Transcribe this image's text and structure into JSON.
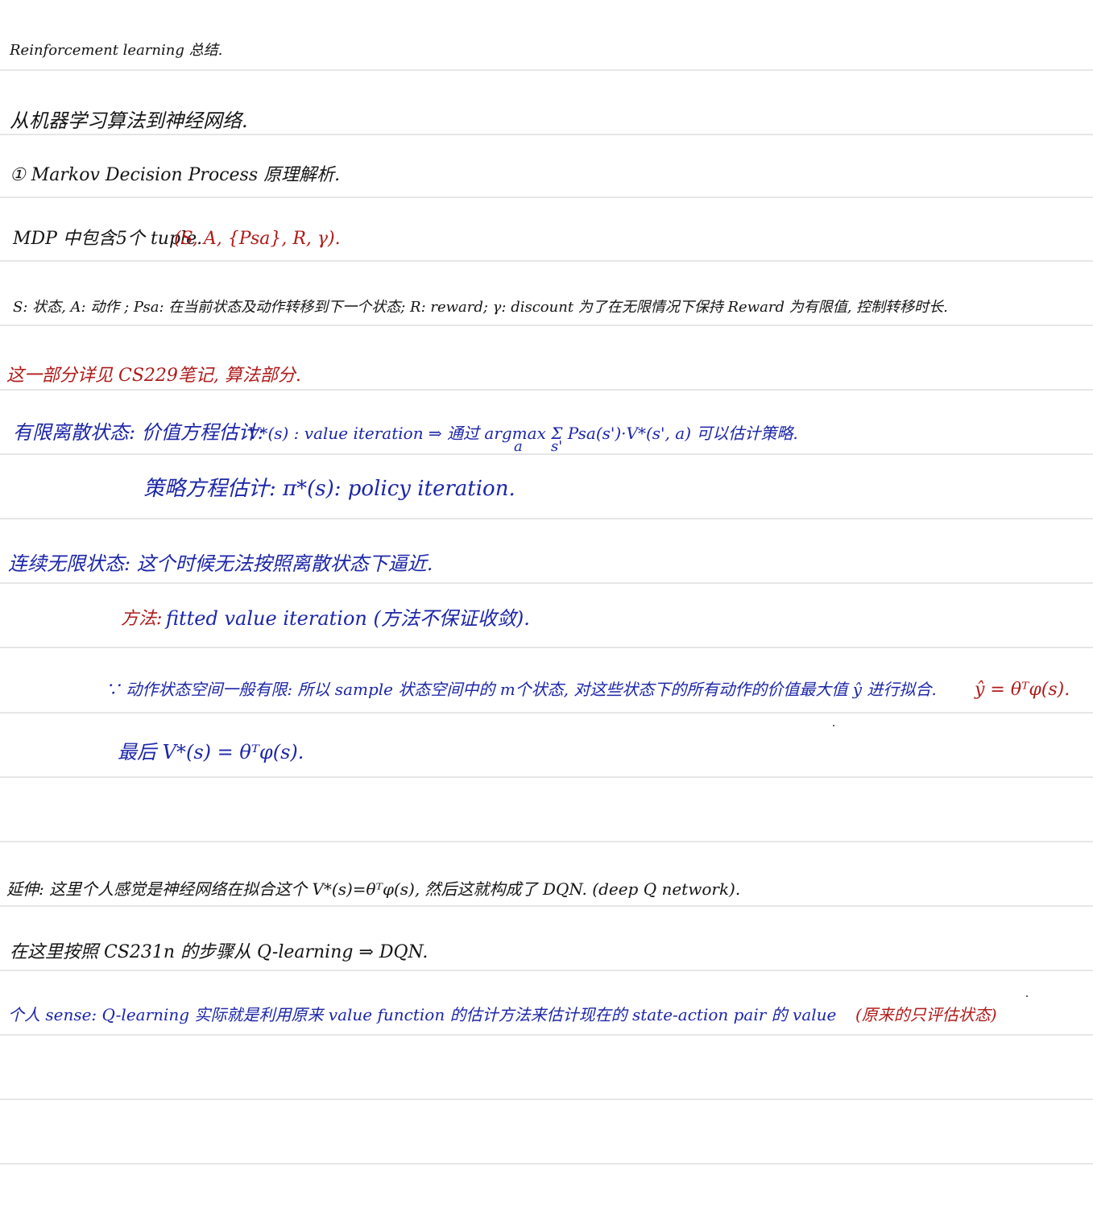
{
  "title": "Reinforcement learning 总结.",
  "lines": {
    "l1": "从机器学习算法到神经网络.",
    "l2": "① Markov Decision Process 原理解析.",
    "l3a": "MDP 中包含5个 tuple.",
    "l3b": "(S, A, {Psa}, R, γ).",
    "l4": "S: 状态, A: 动作 ; Psa: 在当前状态及动作转移到下一个状态; R: reward; γ: discount 为了在无限情况下保持 Reward 为有限值, 控制转移时长.",
    "l5": "这一部分详见 CS229笔记, 算法部分.",
    "l6a": "有限离散状态: 价值方程估计:",
    "l6b": "V*(s) : value iteration ⇒ 通过 argmax Σ Psa(s')·V*(s', a) 可以估计策略.",
    "l6c": "a",
    "l6d": "s'",
    "l7": "策略方程估计: π*(s): policy iteration.",
    "l8": "连续无限状态: 这个时候无法按照离散状态下逼近.",
    "l9a": "方法:",
    "l9b": "fitted value iteration (方法不保证收敛).",
    "l10a": "∵ 动作状态空间一般有限: 所以 sample 状态空间中的 m个状态, 对这些状态下的所有动作的价值最大值 ŷ 进行拟合.",
    "l10b": "ŷ = θᵀφ(s).",
    "l11": "最后 V*(s) = θᵀφ(s).",
    "l12": "延伸: 这里个人感觉是神经网络在拟合这个 V*(s)=θᵀφ(s), 然后这就构成了 DQN. (deep Q network).",
    "l13": "在这里按照 CS231n 的步骤从 Q-learning ⇒ DQN.",
    "l14a": "个人 sense: Q-learning 实际就是利用原来 value function 的估计方法来估计现在的 state-action pair 的 value",
    "l14b": "(原来的只评估状态)"
  },
  "colors": {
    "black_ink": "#141414",
    "red_ink": "#b01a1a",
    "blue_ink": "#1c26a8",
    "rule": "#e6e6e6"
  }
}
